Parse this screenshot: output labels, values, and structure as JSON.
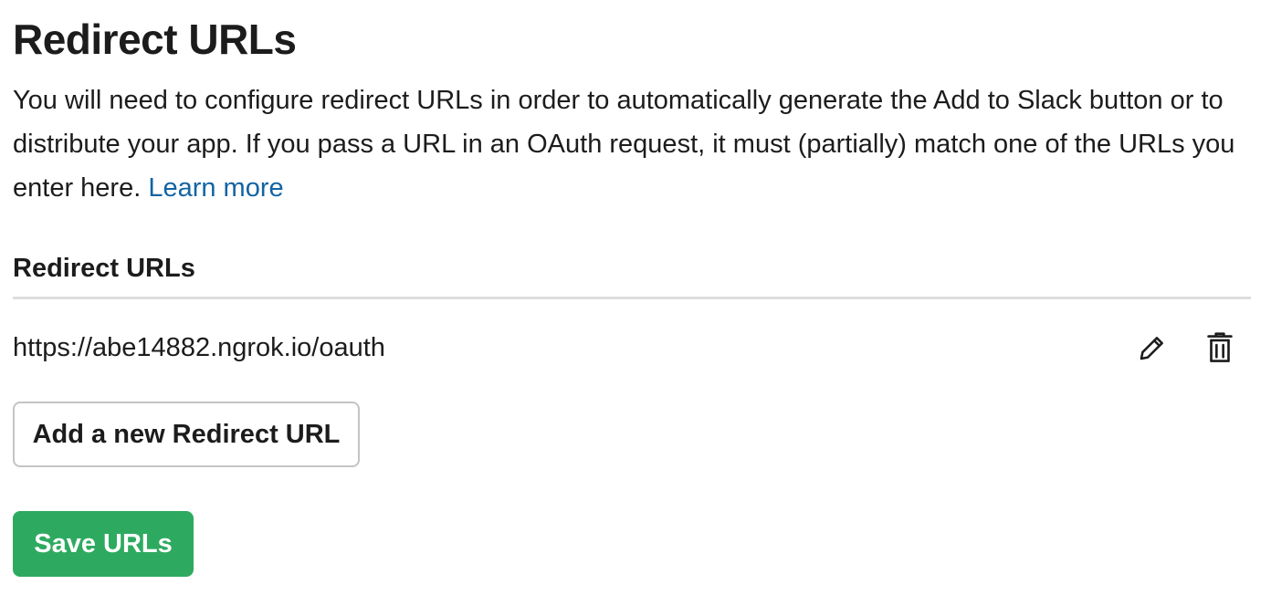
{
  "header": {
    "title": "Redirect URLs"
  },
  "intro": {
    "text": "You will need to configure redirect URLs in order to automatically generate the Add to Slack button or to distribute your app. If you pass a URL in an OAuth request, it must (partially) match one of the URLs you enter here. ",
    "link_label": "Learn more",
    "link_color": "#1264a3"
  },
  "redirect_list": {
    "heading": "Redirect URLs",
    "items": [
      {
        "url": "https://abe14882.ngrok.io/oauth",
        "edit_icon": "pencil-icon",
        "delete_icon": "trash-icon"
      }
    ]
  },
  "actions": {
    "add_label": "Add a new Redirect URL",
    "save_label": "Save URLs",
    "save_color": "#2eaa60"
  }
}
